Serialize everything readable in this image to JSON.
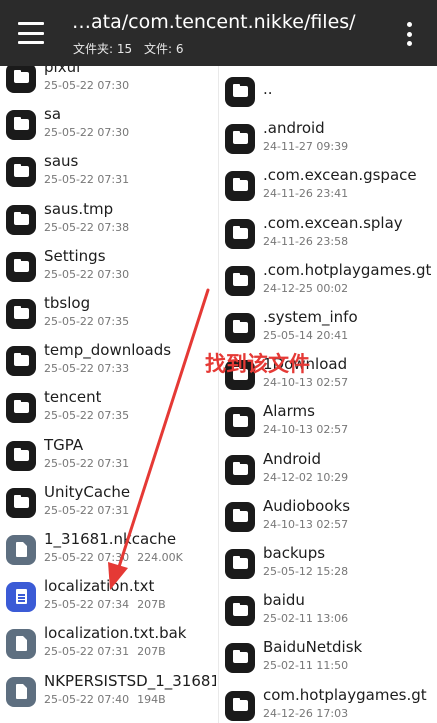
{
  "appbar": {
    "path": "…ata/com.tencent.nikke/files/",
    "folders_label": "文件夹: 15",
    "files_label": "文件: 6"
  },
  "left_items": [
    {
      "name": "pixui",
      "date": "25-05-22 07:30",
      "size": "",
      "type": "folder"
    },
    {
      "name": "sa",
      "date": "25-05-22 07:30",
      "size": "",
      "type": "folder"
    },
    {
      "name": "saus",
      "date": "25-05-22 07:31",
      "size": "",
      "type": "folder"
    },
    {
      "name": "saus.tmp",
      "date": "25-05-22 07:38",
      "size": "",
      "type": "folder"
    },
    {
      "name": "Settings",
      "date": "25-05-22 07:30",
      "size": "",
      "type": "folder"
    },
    {
      "name": "tbslog",
      "date": "25-05-22 07:35",
      "size": "",
      "type": "folder"
    },
    {
      "name": "temp_downloads",
      "date": "25-05-22 07:33",
      "size": "",
      "type": "folder"
    },
    {
      "name": "tencent",
      "date": "25-05-22 07:35",
      "size": "",
      "type": "folder"
    },
    {
      "name": "TGPA",
      "date": "25-05-22 07:31",
      "size": "",
      "type": "folder"
    },
    {
      "name": "UnityCache",
      "date": "25-05-22 07:31",
      "size": "",
      "type": "folder"
    },
    {
      "name": "1_31681.nkcache",
      "date": "25-05-22 07:30",
      "size": "224.00K",
      "type": "file"
    },
    {
      "name": "localization.txt",
      "date": "25-05-22 07:34",
      "size": "207B",
      "type": "doc"
    },
    {
      "name": "localization.txt.bak",
      "date": "25-05-22 07:31",
      "size": "207B",
      "type": "file"
    },
    {
      "name": "NKPERSISTSD_1_31681",
      "date": "25-05-22 07:40",
      "size": "194B",
      "type": "file"
    }
  ],
  "right_items": [
    {
      "name": "..",
      "date": "",
      "type": "folder"
    },
    {
      "name": ".android",
      "date": "24-11-27 09:39",
      "type": "folder"
    },
    {
      "name": ".com.excean.gspace",
      "date": "24-11-26 23:41",
      "type": "folder"
    },
    {
      "name": ".com.excean.splay",
      "date": "24-11-26 23:58",
      "type": "folder"
    },
    {
      "name": ".com.hotplaygames.gt",
      "date": "24-12-25 00:02",
      "type": "folder"
    },
    {
      "name": ".system_info",
      "date": "25-05-14 20:41",
      "type": "folder"
    },
    {
      "name": "1Download",
      "date": "24-10-13 02:57",
      "type": "folder"
    },
    {
      "name": "Alarms",
      "date": "24-10-13 02:57",
      "type": "folder"
    },
    {
      "name": "Android",
      "date": "24-12-02 10:29",
      "type": "folder"
    },
    {
      "name": "Audiobooks",
      "date": "24-10-13 02:57",
      "type": "folder"
    },
    {
      "name": "backups",
      "date": "25-05-12 15:28",
      "type": "folder"
    },
    {
      "name": "baidu",
      "date": "25-02-11 13:06",
      "type": "folder"
    },
    {
      "name": "BaiduNetdisk",
      "date": "25-02-11 11:50",
      "type": "folder"
    },
    {
      "name": "com.hotplaygames.gt",
      "date": "24-12-26 17:03",
      "type": "folder"
    }
  ],
  "annotation": {
    "text": "找到该文件",
    "color": "#e53935"
  },
  "colors": {
    "appbar": "#2b2b2b",
    "folder_icon": "#1a1a1a",
    "file_icon": "#5e6f80",
    "txt_icon": "#3b5bd6"
  }
}
